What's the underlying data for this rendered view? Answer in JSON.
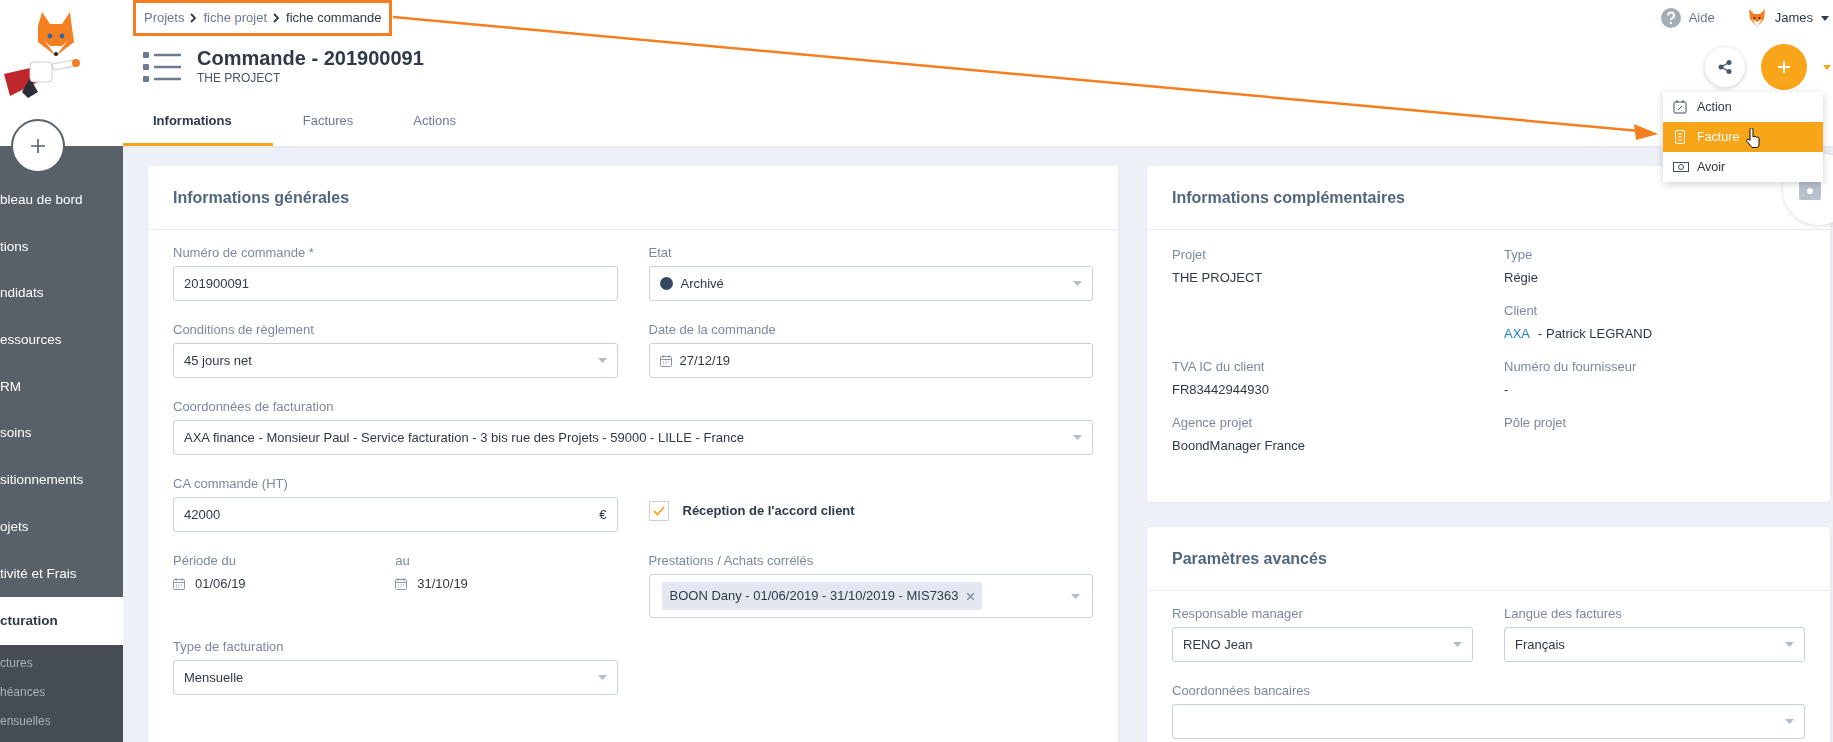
{
  "sidebar": {
    "items": [
      {
        "label": "bleau de bord",
        "selected": false
      },
      {
        "label": "tions",
        "selected": false
      },
      {
        "label": "ndidats",
        "selected": false
      },
      {
        "label": "essources",
        "selected": false
      },
      {
        "label": "RM",
        "selected": false
      },
      {
        "label": "soins",
        "selected": false
      },
      {
        "label": "sitionnements",
        "selected": false
      },
      {
        "label": "ojets",
        "selected": false
      },
      {
        "label": "tivité et Frais",
        "selected": false
      },
      {
        "label": "cturation",
        "selected": true,
        "children": [
          {
            "label": "ctures",
            "selected": false
          },
          {
            "label": "héances",
            "selected": false
          },
          {
            "label": "ensuelles",
            "selected": false
          }
        ]
      }
    ]
  },
  "breadcrumb": [
    {
      "label": "Projets"
    },
    {
      "label": "fiche projet"
    },
    {
      "label": "fiche commande"
    }
  ],
  "topbar": {
    "help": "Aide",
    "user": "James"
  },
  "header": {
    "title": "Commande - 201900091",
    "subtitle": "THE PROJECT"
  },
  "tabs": [
    {
      "label": "Informations",
      "selected": true
    },
    {
      "label": "Factures",
      "selected": false
    },
    {
      "label": "Actions",
      "selected": false
    }
  ],
  "add_menu": {
    "items": [
      {
        "label": "Action",
        "selected": false
      },
      {
        "label": "Facture",
        "selected": true
      },
      {
        "label": "Avoir",
        "selected": false
      }
    ]
  },
  "general": {
    "title": "Informations générales",
    "rows": [
      [
        {
          "kind": "text",
          "label": "Numéro de commande *",
          "value": "201900091"
        },
        {
          "kind": "select",
          "label": "Etat",
          "value": "Archivé",
          "color": "#34495e"
        }
      ],
      [
        {
          "kind": "select",
          "label": "Conditions de règlement",
          "value": "45 jours net"
        },
        {
          "kind": "date",
          "label": "Date de la commande",
          "value": "27/12/19"
        }
      ],
      [
        {
          "kind": "wide_select",
          "label": "Coordonnées de facturation",
          "value": "AXA finance - Monsieur Paul - Service facturation - 3 bis rue des Projets - 59000 - LILLE - France"
        }
      ],
      [
        {
          "kind": "text",
          "label": "CA commande (HT)",
          "value": "42000",
          "suffix": "€"
        },
        {
          "kind": "checkbox",
          "label": "Réception de l'accord client",
          "checked": true
        }
      ],
      [
        {
          "kind": "period",
          "from_label": "Période du",
          "from": "01/06/19",
          "to_label": "au",
          "to": "31/10/19"
        },
        {
          "kind": "tags",
          "label": "Prestations / Achats corrélés",
          "tags": [
            "BOON Dany - 01/06/2019 - 31/10/2019 - MIS7363"
          ]
        }
      ],
      [
        {
          "kind": "select",
          "label": "Type de facturation",
          "value": "Mensuelle"
        }
      ]
    ]
  },
  "complementary": {
    "title": "Informations complémentaires",
    "rows": [
      {
        "left": {
          "label": "Projet",
          "value": "THE PROJECT"
        },
        "right": {
          "label": "Type",
          "value": "Régie"
        }
      },
      {
        "right": {
          "label": "Client",
          "link": "AXA",
          "value": "-  Patrick LEGRAND"
        }
      },
      {
        "left": {
          "label": "TVA IC du client",
          "value": "FR83442944930"
        },
        "right": {
          "label": "Numéro du fournisseur",
          "value": "-"
        }
      },
      {
        "left": {
          "label": "Agence projet",
          "value": "BoondManager France"
        },
        "right": {
          "label": "Pôle projet"
        }
      }
    ]
  },
  "advanced": {
    "title": "Paramètres avancés",
    "rows": [
      [
        {
          "kind": "select",
          "label": "Responsable manager",
          "value": "RENO Jean"
        },
        {
          "kind": "select",
          "label": "Langue des factures",
          "value": "Français"
        }
      ],
      [
        {
          "kind": "wide_select",
          "label": "Coordonnées bancaires"
        }
      ]
    ]
  }
}
